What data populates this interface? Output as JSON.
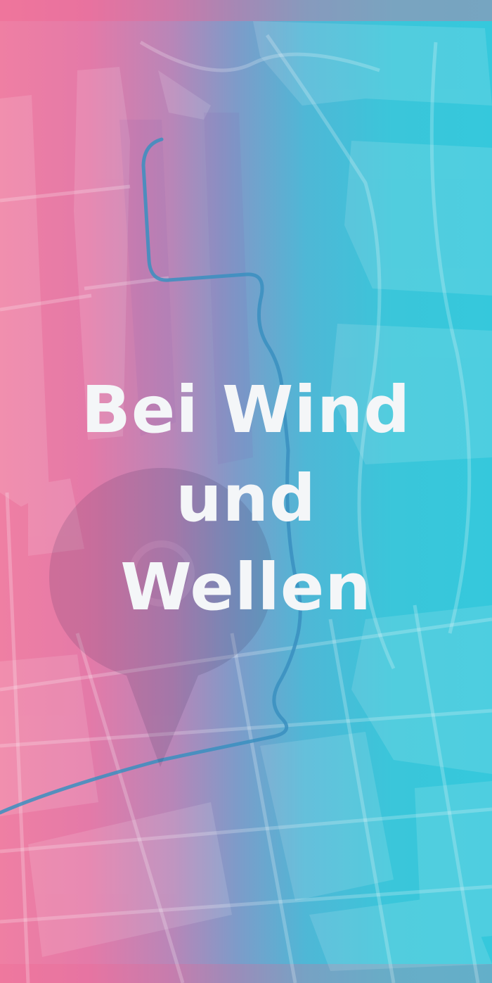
{
  "screen": {
    "title_lines": [
      "Bei Wind",
      "und",
      "Wellen"
    ]
  },
  "colors": {
    "gradient_left": "#ef7fa3",
    "gradient_right": "#35c8dc",
    "title_text": "#f4f6f8",
    "route_line": "#3b8fc0"
  },
  "icons": [
    "map-background",
    "camera-pin-icon"
  ]
}
